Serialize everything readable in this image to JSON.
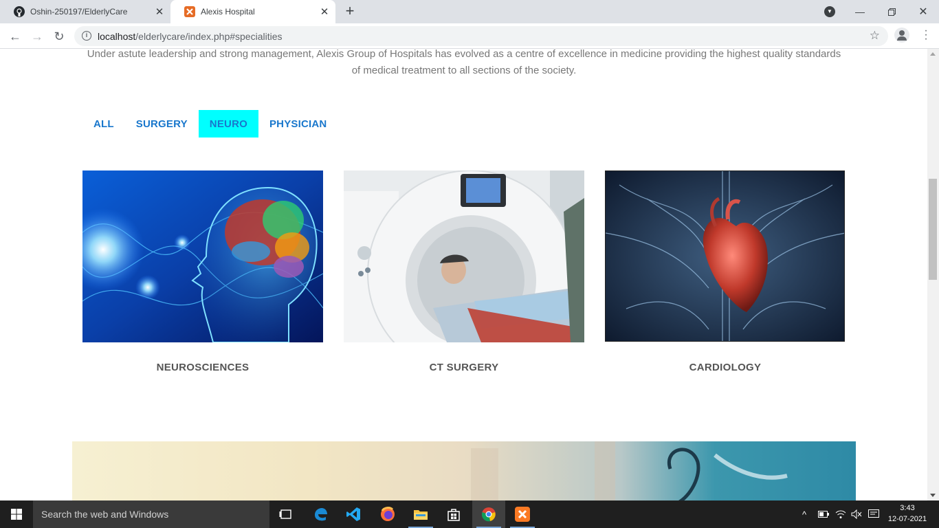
{
  "browser": {
    "tabs": [
      {
        "title": "Oshin-250197/ElderlyCare",
        "icon": "github-icon",
        "active": false
      },
      {
        "title": "Alexis Hospital",
        "icon": "xampp-icon",
        "active": true
      }
    ],
    "url_host": "localhost",
    "url_path": "/elderlycare/index.php#specialities"
  },
  "page": {
    "intro": "Under astute leadership and strong management, Alexis Group of Hospitals has evolved as a centre of excellence in medicine providing the highest quality standards of medical treatment to all sections of the society.",
    "filters": [
      {
        "label": "ALL",
        "active": false
      },
      {
        "label": "SURGERY",
        "active": false
      },
      {
        "label": "NEURO",
        "active": true
      },
      {
        "label": "PHYSICIAN",
        "active": false
      }
    ],
    "specialities": [
      {
        "name": "NEUROSCIENCES",
        "image": "brain-illustration"
      },
      {
        "name": "CT SURGERY",
        "image": "ct-scanner-photo"
      },
      {
        "name": "CARDIOLOGY",
        "image": "heart-illustration"
      }
    ],
    "active_filter_color": "#00ffff",
    "accent_color": "#1977cc"
  },
  "taskbar": {
    "search_placeholder": "Search the web and Windows",
    "time": "3:43",
    "date": "12-07-2021"
  }
}
